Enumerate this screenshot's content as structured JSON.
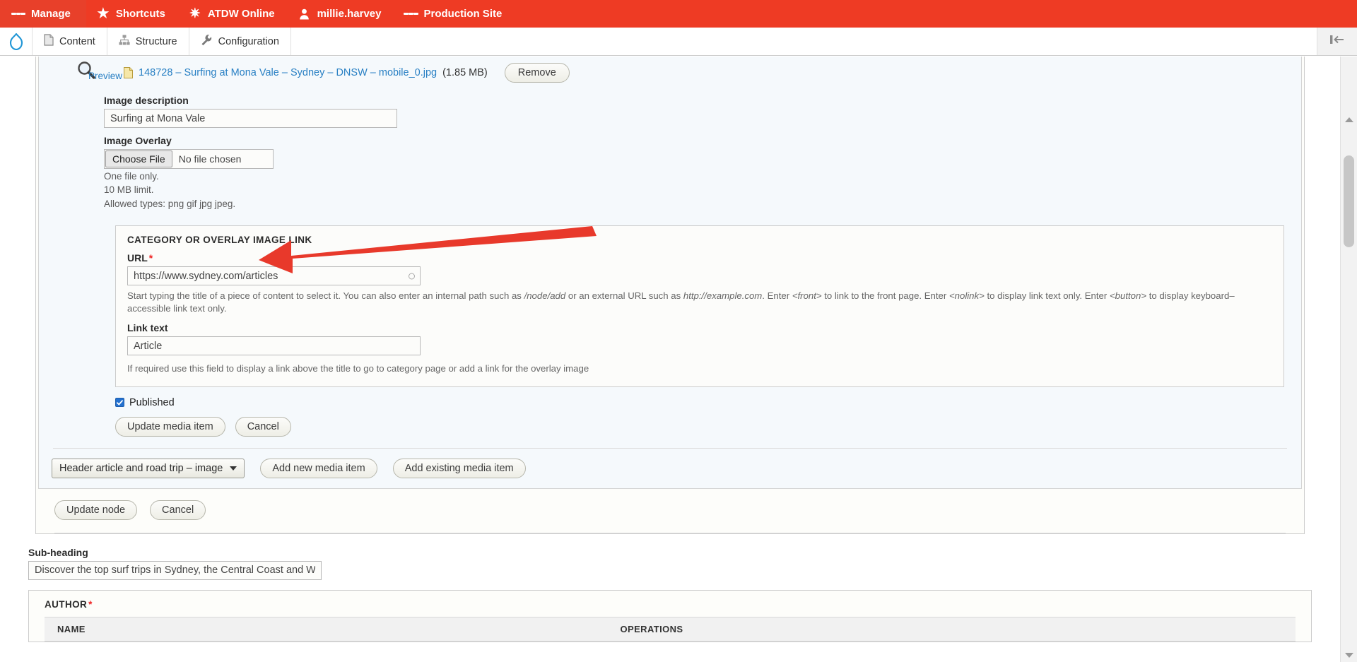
{
  "toolbar": {
    "items": [
      {
        "label": "Manage",
        "icon": "hamburger-icon"
      },
      {
        "label": "Shortcuts",
        "icon": "star-icon"
      },
      {
        "label": "ATDW Online",
        "icon": "gear-icon"
      },
      {
        "label": "millie.harvey",
        "icon": "person-icon"
      },
      {
        "label": "Production Site",
        "icon": "server-icon"
      }
    ],
    "accent_color": "#ee3b24"
  },
  "subnav": {
    "items": [
      {
        "label": "Content",
        "icon": "document-icon"
      },
      {
        "label": "Structure",
        "icon": "structure-icon"
      },
      {
        "label": "Configuration",
        "icon": "wrench-icon"
      }
    ],
    "collapse_icon": "collapse-sidebar-icon"
  },
  "media_item": {
    "preview_label": "Preview",
    "file_name": "148728 – Surfing at Mona Vale – Sydney – DNSW – mobile_0.jpg",
    "file_size": "(1.85 MB)",
    "remove_label": "Remove",
    "image_description": {
      "label": "Image description",
      "value": "Surfing at Mona Vale"
    },
    "image_overlay": {
      "label": "Image Overlay",
      "choose_file_label": "Choose File",
      "no_file_text": "No file chosen",
      "hints": [
        "One file only.",
        "10 MB limit.",
        "Allowed types: png gif jpg jpeg."
      ]
    },
    "link_fieldset": {
      "legend": "CATEGORY OR OVERLAY IMAGE LINK",
      "url": {
        "label": "URL",
        "required": "*",
        "value": "https://www.sydney.com/articles",
        "description_parts": [
          {
            "text": "Start typing the title of a piece of content to select it. You can also enter an internal path such as ",
            "italic": false
          },
          {
            "text": "/node/add",
            "italic": true
          },
          {
            "text": " or an external URL such as ",
            "italic": false
          },
          {
            "text": "http://example.com",
            "italic": true
          },
          {
            "text": ". Enter ",
            "italic": false
          },
          {
            "text": "<front>",
            "italic": true
          },
          {
            "text": " to link to the front page. Enter ",
            "italic": false
          },
          {
            "text": "<nolink>",
            "italic": true
          },
          {
            "text": " to display link text only. Enter ",
            "italic": false
          },
          {
            "text": "<button>",
            "italic": true
          },
          {
            "text": " to display keyboard–accessible link text only.",
            "italic": false
          }
        ]
      },
      "link_text": {
        "label": "Link text",
        "value": "Article",
        "description": "If required use this field to display a link above the title to go to category page or add a link for the overlay image"
      }
    },
    "published": {
      "label": "Published",
      "checked": true
    },
    "update_label": "Update media item",
    "cancel_label": "Cancel"
  },
  "add_row": {
    "select_value": "Header article and road trip – image",
    "add_new_label": "Add new media item",
    "add_existing_label": "Add existing media item"
  },
  "node_actions": {
    "update_label": "Update node",
    "cancel_label": "Cancel"
  },
  "sub_heading": {
    "label": "Sub-heading",
    "value": "Discover the top surf trips in Sydney, the Central Coast and Wollongong with e"
  },
  "author": {
    "legend": "AUTHOR",
    "required": "*",
    "columns": [
      "NAME",
      "OPERATIONS"
    ]
  },
  "annotation": {
    "type": "arrow",
    "color": "#e8392b",
    "points_to": "CATEGORY OR OVERLAY IMAGE LINK"
  }
}
